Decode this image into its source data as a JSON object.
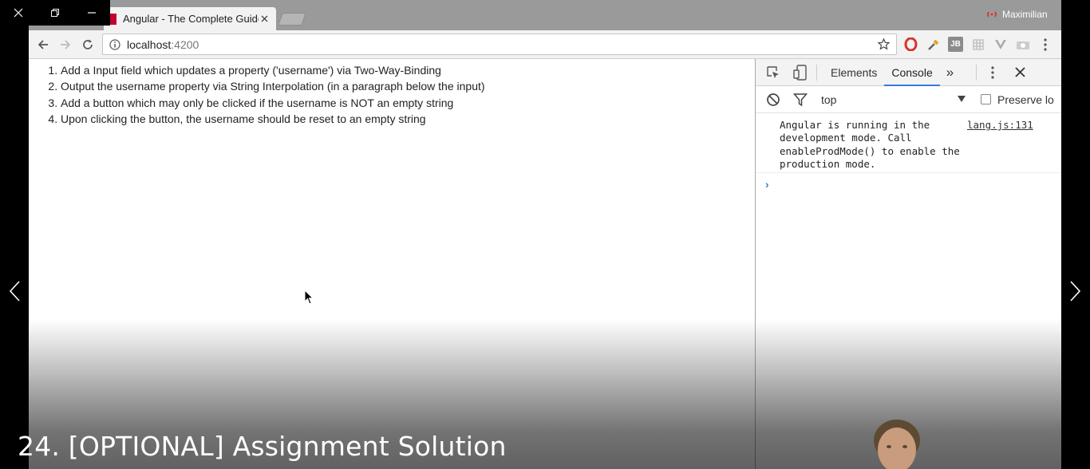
{
  "window": {
    "close_label": "close",
    "restore_label": "restore",
    "minimize_label": "minimize"
  },
  "browser": {
    "tab_title": "Angular - The Complete Guide",
    "profile_name": "Maximilian",
    "url_host": "localhost",
    "url_port": ":4200",
    "extensions": [
      "opera-icon",
      "eyedropper-icon",
      "JB",
      "grid-icon",
      "vue-icon",
      "camera-icon"
    ],
    "ext_jb_label": "JB"
  },
  "page": {
    "tasks": [
      "Add a Input field which updates a property ('username') via Two-Way-Binding",
      "Output the username property via String Interpolation (in a paragraph below the input)",
      "Add a button which may only be clicked if the username is NOT an empty string",
      "Upon clicking the button, the username should be reset to an empty string"
    ]
  },
  "devtools": {
    "tabs": [
      "Elements",
      "Console"
    ],
    "active_tab": "Console",
    "more_tabs": "»",
    "context": "top",
    "preserve_log": "Preserve lo",
    "log_message": "Angular is running in the\ndevelopment mode. Call\nenableProdMode() to enable the\nproduction mode.",
    "log_source": "lang.js:131",
    "prompt": "›"
  },
  "overlay": {
    "lecture_title": "24. [OPTIONAL] Assignment Solution"
  },
  "colors": {
    "accent": "#3879d9",
    "tabbar": "#9a9a9a",
    "toolbar": "#f2f2f2"
  }
}
